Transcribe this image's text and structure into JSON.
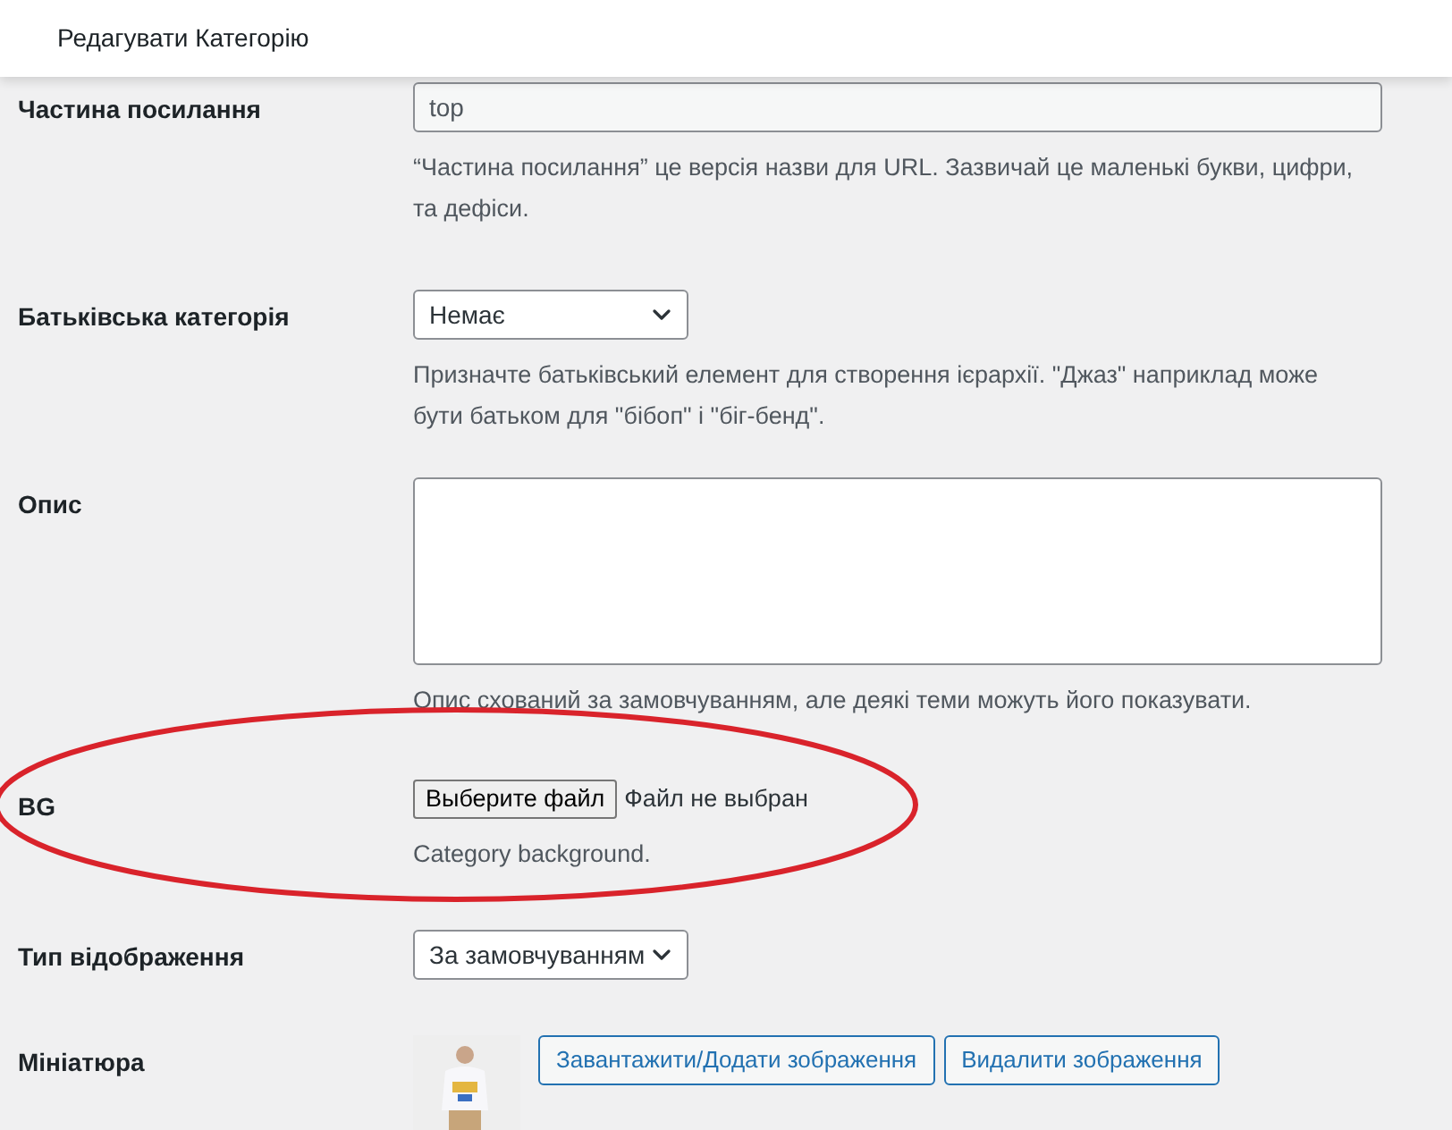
{
  "header": {
    "title": "Редагувати Категорію"
  },
  "fields": [
    {
      "kind": "text",
      "label": "Частина посилання",
      "value": "top",
      "hint": "“Частина посилання” це версія назви для URL. Зазвичай це маленькі букви, цифри, та дефіси."
    },
    {
      "kind": "select",
      "label": "Батьківська категорія",
      "value": "Немає",
      "hint": "Призначте батьківський елемент для створення ієрархії. \"Джаз\" наприклад може бути батьком для \"бібоп\" і \"біг-бенд\"."
    },
    {
      "kind": "textarea",
      "label": "Опис",
      "hint": "Опис схований за замовчуванням, але деякі теми можуть його показувати."
    },
    {
      "kind": "file",
      "label": "BG",
      "button": "Выберите файл",
      "status": "Файл не выбран",
      "hint": "Category background."
    },
    {
      "kind": "select",
      "label": "Тип відображення",
      "value": "За замовчуванням"
    },
    {
      "kind": "thumbnail",
      "label": "Мініатюра",
      "buttons": [
        "Завантажити/Додати зображення",
        "Видалити зображення"
      ]
    }
  ]
}
